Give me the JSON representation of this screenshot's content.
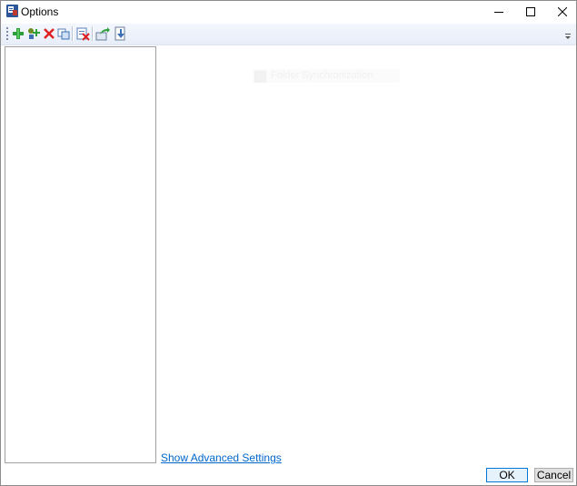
{
  "window": {
    "title": "Options"
  },
  "titlebar_controls": {
    "minimize_icon": "minimize-icon",
    "maximize_icon": "maximize-icon",
    "close_icon": "close-icon"
  },
  "toolbar": {
    "buttons": [
      {
        "icon": "add-icon"
      },
      {
        "icon": "add-group-icon"
      },
      {
        "icon": "delete-icon"
      },
      {
        "icon": "copy-icon"
      },
      {
        "icon": "remove-all-icon"
      },
      {
        "icon": "export-icon"
      },
      {
        "icon": "import-icon"
      }
    ]
  },
  "ghost_item": {
    "label": "Folder Synchronization"
  },
  "links": {
    "advanced_settings": "Show Advanced Settings"
  },
  "buttons": {
    "ok": "OK",
    "cancel": "Cancel"
  },
  "colors": {
    "link": "#0066cc",
    "ok_border": "#0078d7",
    "annotation_arrow": "#e81123"
  }
}
